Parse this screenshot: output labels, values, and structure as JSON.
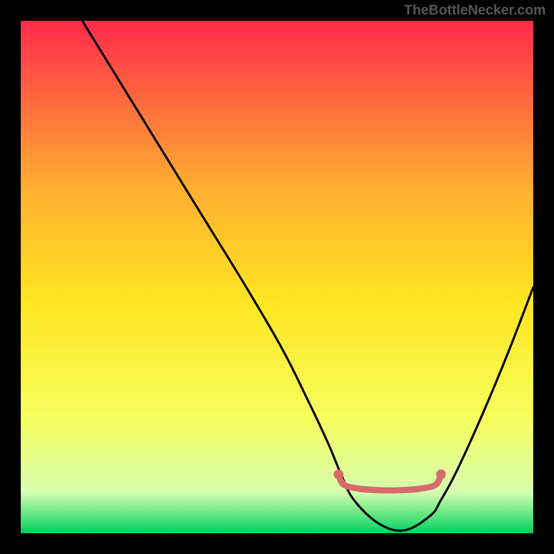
{
  "watermark": "TheBottleNecker.com",
  "chart_data": {
    "type": "line",
    "title": "",
    "xlabel": "",
    "ylabel": "",
    "xlim": [
      0,
      100
    ],
    "ylim": [
      0,
      100
    ],
    "background_gradient": {
      "top": "#ff2a4b",
      "upper_mid": "#ffb030",
      "mid": "#ffe522",
      "lower_mid": "#f7ff60",
      "near_bottom": "#d6ffb0",
      "bottom": "#00d060"
    },
    "series": [
      {
        "name": "curve",
        "stroke": "#000000",
        "x": [
          12,
          20,
          28,
          36,
          44,
          51,
          56,
          60,
          62.5,
          65,
          70,
          75,
          80,
          82,
          85,
          90,
          95,
          100
        ],
        "y": [
          100,
          87,
          74,
          61,
          48,
          36,
          26,
          17.5,
          11.5,
          6.5,
          1.8,
          0.6,
          3.5,
          6.5,
          12,
          23,
          35,
          48
        ]
      },
      {
        "name": "marker-band",
        "stroke": "#d86a6a",
        "x": [
          62,
          63,
          66,
          70,
          74,
          78,
          81,
          82
        ],
        "y": [
          11.5,
          9.5,
          8.7,
          8.4,
          8.4,
          8.7,
          9.5,
          11.5
        ]
      }
    ],
    "markers": [
      {
        "x": 62,
        "y": 11.5,
        "r": 2.6,
        "fill": "#d86a6a"
      },
      {
        "x": 82,
        "y": 11.5,
        "r": 2.6,
        "fill": "#d86a6a"
      }
    ]
  }
}
